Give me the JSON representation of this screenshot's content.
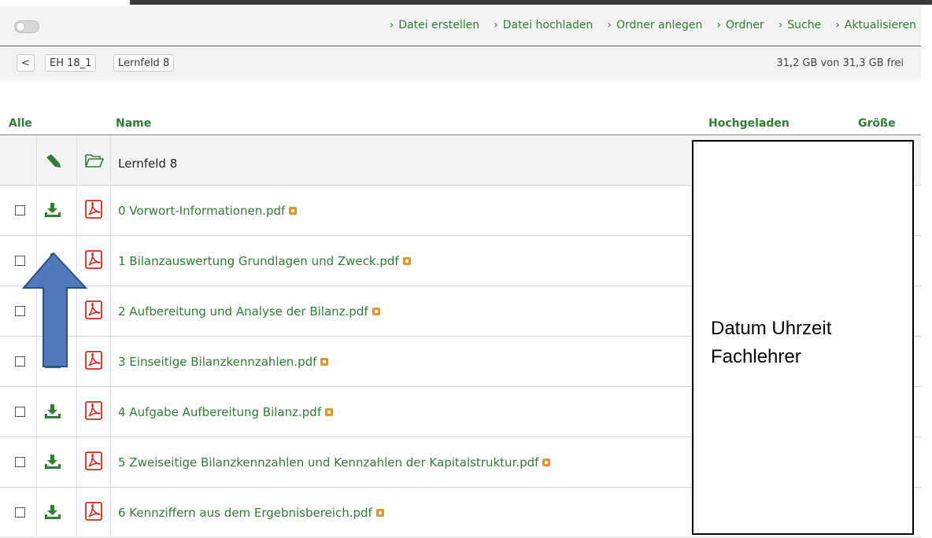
{
  "toolbar": {
    "actions": [
      {
        "label": "Datei erstellen"
      },
      {
        "label": "Datei hochladen"
      },
      {
        "label": "Ordner anlegen"
      },
      {
        "label": "Ordner"
      },
      {
        "label": "Suche"
      },
      {
        "label": "Aktualisieren"
      }
    ]
  },
  "path": {
    "back": "<",
    "crumbs": [
      "EH 18_1",
      "Lernfeld 8"
    ],
    "space": "31,2 GB von 31,3 GB frei"
  },
  "table": {
    "headers": {
      "all": "Alle",
      "name": "Name",
      "uploaded": "Hochgeladen",
      "size": "Größe"
    },
    "folder": {
      "name": "Lernfeld 8"
    },
    "files": [
      {
        "name": "0 Vorwort-Informationen.pdf"
      },
      {
        "name": "1 Bilanzauswertung Grundlagen und Zweck.pdf"
      },
      {
        "name": "2 Aufbereitung und Analyse der Bilanz.pdf"
      },
      {
        "name": "3 Einseitige Bilanzkennzahlen.pdf"
      },
      {
        "name": "4 Aufgabe Aufbereitung Bilanz.pdf"
      },
      {
        "name": "5 Zweiseitige Bilanzkennzahlen und Kennzahlen der Kapitalstruktur.pdf"
      },
      {
        "name": "6 Kennziffern aus dem Ergebnisbereich.pdf"
      }
    ]
  },
  "overlay": {
    "line1": "Datum Uhrzeit",
    "line2": "Fachlehrer"
  },
  "colors": {
    "accent": "#2f7d32",
    "pdf": "#d9261c",
    "arrow": "#4f7bbd",
    "star": "#e8912f"
  }
}
